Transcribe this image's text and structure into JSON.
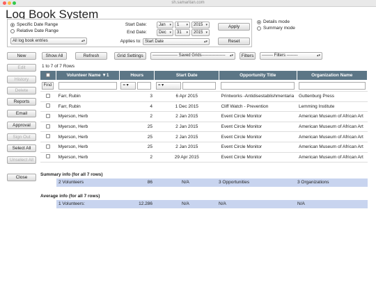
{
  "browser": {
    "url": "sh.samaritan.com"
  },
  "app": {
    "title": "Log Book System"
  },
  "filters": {
    "specific_range": "Specific Date Range",
    "relative_range": "Relative Date Range",
    "entries_select": "All log book entries",
    "start_label": "Start Date:",
    "end_label": "End Date:",
    "start": {
      "month": "Jan",
      "day": "1",
      "year": "2015"
    },
    "end": {
      "month": "Dec",
      "day": "31",
      "year": "2015"
    },
    "applies_label": "Applies to:",
    "applies_value": "Start Date",
    "apply": "Apply",
    "reset": "Reset"
  },
  "modes": {
    "details": "Details mode",
    "summary": "Summary mode"
  },
  "toolbar": {
    "new": "New",
    "show_all": "Show All",
    "refresh": "Refresh",
    "grid_settings": "Grid Settings",
    "saved_grids": "------------------ Saved Grids-----------------",
    "filters": "Filters",
    "filters_select": "-------- Filters --------"
  },
  "side": {
    "edit": "Edit",
    "history": "History",
    "delete": "Delete",
    "reports": "Reports",
    "email": "Email",
    "approval": "Approval",
    "signout": "Sign Out",
    "select_all": "Select All",
    "unselect_all": "Unselect All",
    "close": "Close"
  },
  "grid": {
    "count": "1 to 7 of 7 Rows",
    "headers": [
      "Volunteer Name ▼1",
      "Hours",
      "Start Date",
      "Opportunity Title",
      "Organization Name"
    ],
    "find": "Find",
    "op_eq": "=",
    "rows": [
      [
        "Farr, Rubin",
        "3",
        "6 Apr 2015",
        "Printworks -Antidisestablishmentaria",
        "Guttenburg Press"
      ],
      [
        "Farr, Rubin",
        "4",
        "1 Dec 2015",
        "Cliff  Watch - Prevention",
        "Lemming Institute"
      ],
      [
        "Myerson, Herb",
        "2",
        "2 Jan 2015",
        "Event Circle Monitor",
        "American Museum of African Art"
      ],
      [
        "Myerson, Herb",
        "25",
        "2 Jan 2015",
        "Event Circle Monitor",
        "American Museum of African Art"
      ],
      [
        "Myerson, Herb",
        "25",
        "2 Jan 2015",
        "Event Circle Monitor",
        "American Museum of African Art"
      ],
      [
        "Myerson, Herb",
        "25",
        "2 Jan 2015",
        "Event Circle Monitor",
        "American Museum of African Art"
      ],
      [
        "Myerson, Herb",
        "2",
        "29 Apr 2015",
        "Event Circle Monitor",
        "American Museum of African Art"
      ]
    ]
  },
  "summary": {
    "label": "Summary info (for all 7 rows)",
    "values": [
      "2 Volunteers",
      "86",
      "N/A",
      "3 Opportunities",
      "3 Organizations"
    ]
  },
  "average": {
    "label": "Average info (for all 7 rows)",
    "values": [
      "1 Volunteers:",
      "12.286",
      "N/A",
      "N/A",
      "N/A"
    ]
  }
}
